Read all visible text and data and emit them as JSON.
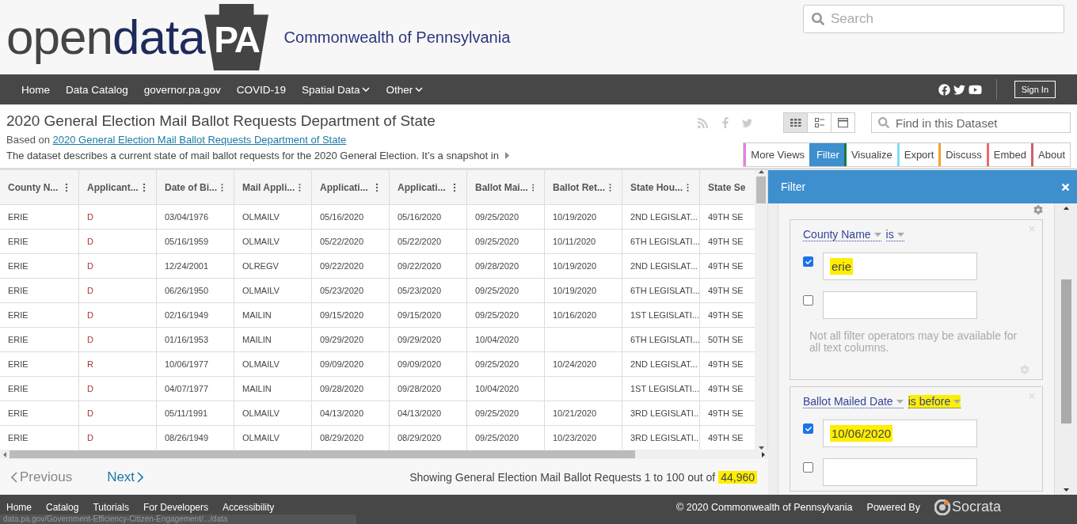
{
  "header": {
    "logo": {
      "part_1": "open",
      "part_2": "data",
      "badge": "PA"
    },
    "tagline": "Commonwealth of Pennsylvania",
    "search": {
      "placeholder": "Search"
    }
  },
  "nav": {
    "items": [
      {
        "label": "Home",
        "dropdown": false
      },
      {
        "label": "Data Catalog",
        "dropdown": false
      },
      {
        "label": "governor.pa.gov",
        "dropdown": false
      },
      {
        "label": "COVID-19",
        "dropdown": false
      },
      {
        "label": "Spatial Data",
        "dropdown": true
      },
      {
        "label": "Other",
        "dropdown": true
      }
    ],
    "sign_in": "Sign In"
  },
  "dataset": {
    "title": "2020 General Election Mail Ballot Requests Department of State",
    "based_on_label": "Based on",
    "based_on_link": "2020 General Election Mail Ballot Requests Department of State",
    "description": "The dataset describes a current state of mail ballot requests for the 2020 General Election. It’s a snapshot in",
    "views": [
      {
        "kind": "grid",
        "selected": true
      },
      {
        "kind": "list",
        "selected": false
      },
      {
        "kind": "page",
        "selected": false
      }
    ],
    "find": {
      "placeholder": "Find in this Dataset"
    },
    "tabs": [
      {
        "label": "More Views",
        "selected": false,
        "color": "#e67fe6"
      },
      {
        "label": "Filter",
        "selected": true,
        "color": "#3d8fce"
      },
      {
        "label": "Visualize",
        "selected": false,
        "color": "#1a7a3a"
      },
      {
        "label": "Export",
        "selected": false,
        "color": "#80dcf5"
      },
      {
        "label": "Discuss",
        "selected": false,
        "color": "#f5a030"
      },
      {
        "label": "Embed",
        "selected": false,
        "color": "#f06a6a"
      },
      {
        "label": "About",
        "selected": false,
        "color": "#d0606a"
      }
    ]
  },
  "table": {
    "columns": [
      "County N...",
      "Applicant...",
      "Date of Bi...",
      "Mail Appli...",
      "Applicati...",
      "Applicati...",
      "Ballot Mai...",
      "Ballot Ret...",
      "State Hou...",
      "State Se"
    ],
    "rows": [
      [
        "ERIE",
        "D",
        "03/04/1976",
        "OLMAILV",
        "05/16/2020",
        "05/16/2020",
        "09/25/2020",
        "10/19/2020",
        "2ND LEGISLAT...",
        "49TH SE"
      ],
      [
        "ERIE",
        "D",
        "05/16/1959",
        "OLMAILV",
        "05/22/2020",
        "05/22/2020",
        "09/25/2020",
        "10/11/2020",
        "6TH LEGISLATI...",
        "49TH SE"
      ],
      [
        "ERIE",
        "D",
        "12/24/2001",
        "OLREGV",
        "09/22/2020",
        "09/22/2020",
        "09/28/2020",
        "10/19/2020",
        "2ND LEGISLAT...",
        "49TH SE"
      ],
      [
        "ERIE",
        "D",
        "06/26/1950",
        "OLMAILV",
        "05/23/2020",
        "05/23/2020",
        "09/25/2020",
        "10/19/2020",
        "6TH LEGISLATI...",
        "49TH SE"
      ],
      [
        "ERIE",
        "D",
        "02/16/1949",
        "MAILIN",
        "09/15/2020",
        "09/15/2020",
        "09/25/2020",
        "10/16/2020",
        "1ST LEGISLATI...",
        "49TH SE"
      ],
      [
        "ERIE",
        "D",
        "01/16/1953",
        "MAILIN",
        "09/29/2020",
        "09/29/2020",
        "10/04/2020",
        "",
        "6TH LEGISLATI...",
        "50TH SE"
      ],
      [
        "ERIE",
        "R",
        "10/06/1977",
        "OLMAILV",
        "09/09/2020",
        "09/09/2020",
        "09/25/2020",
        "10/24/2020",
        "2ND LEGISLAT...",
        "49TH SE"
      ],
      [
        "ERIE",
        "D",
        "04/07/1977",
        "MAILIN",
        "09/28/2020",
        "09/28/2020",
        "10/04/2020",
        "",
        "1ST LEGISLATI...",
        "49TH SE"
      ],
      [
        "ERIE",
        "D",
        "05/11/1991",
        "OLMAILV",
        "04/13/2020",
        "04/13/2020",
        "09/25/2020",
        "10/21/2020",
        "3RD LEGISLATI...",
        "49TH SE"
      ],
      [
        "ERIE",
        "D",
        "08/26/1949",
        "OLMAILV",
        "08/29/2020",
        "08/29/2020",
        "09/25/2020",
        "10/23/2020",
        "3RD LEGISLATI...",
        "49TH SE"
      ]
    ]
  },
  "pagination": {
    "previous": "Previous",
    "next": "Next",
    "summary": "Showing General Election Mail Ballot Requests 1 to 100 out of",
    "total": "44,960",
    "total_highlighted": true
  },
  "filter_panel": {
    "title": "Filter",
    "filters": [
      {
        "column": "County Name",
        "operator": "is",
        "operator_highlighted": false,
        "values": [
          {
            "value": "erie",
            "checked": true,
            "highlighted": true
          },
          {
            "checked": false
          }
        ],
        "note": "Not all filter operators may be available for all text columns."
      },
      {
        "column": "Ballot Mailed Date",
        "operator": "is before",
        "operator_highlighted": true,
        "values": [
          {
            "value": "10/06/2020",
            "checked": true,
            "highlighted": true
          },
          {
            "checked": false
          }
        ]
      }
    ]
  },
  "footer": {
    "links": [
      "Home",
      "Catalog",
      "Tutorials",
      "For Developers",
      "Accessibility"
    ],
    "copyright": "© 2020 Commonwealth of Pennsylvania",
    "powered_by": "Powered By",
    "brand": "Socrata"
  },
  "status_url": "data.pa.gov/Government-Efficiency-Citizen-Engagement/.../data"
}
